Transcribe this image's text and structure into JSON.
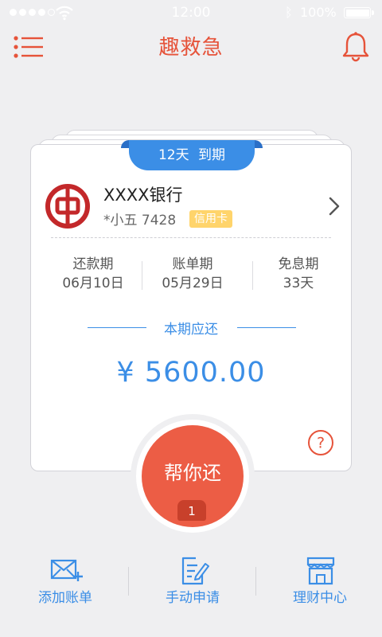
{
  "status_bar": {
    "time": "12:00",
    "bluetooth_symbol": "ᛒ",
    "battery_text": "100%",
    "signal_dots_filled": 4,
    "signal_dots_total": 5,
    "battery_level": 1.0
  },
  "header": {
    "title": "趣救急",
    "menu_icon": "menu-icon",
    "bell_icon": "bell-icon"
  },
  "card": {
    "due_ribbon": "12天 到期",
    "bank_name": "XXXX银行",
    "card_holder": "*小五 7428",
    "card_type": "信用卡",
    "info": [
      {
        "label": "还款期",
        "value": "06月10日"
      },
      {
        "label": "账单期",
        "value": "05月29日"
      },
      {
        "label": "免息期",
        "value": "33天"
      }
    ],
    "due_label": "本期应还",
    "amount": "¥ 5600.00",
    "help_symbol": "?"
  },
  "main_action": {
    "label": "帮你还",
    "badge": "1"
  },
  "tabs": [
    {
      "label": "添加账单",
      "icon": "add-mail-icon"
    },
    {
      "label": "手动申请",
      "icon": "edit-document-icon"
    },
    {
      "label": "理财中心",
      "icon": "store-icon"
    }
  ],
  "colors": {
    "accent_red": "#e6533a",
    "button_red": "#ec5d45",
    "accent_blue": "#3b8ee6",
    "tag_yellow": "#ffd46b",
    "background": "#efeff1"
  }
}
